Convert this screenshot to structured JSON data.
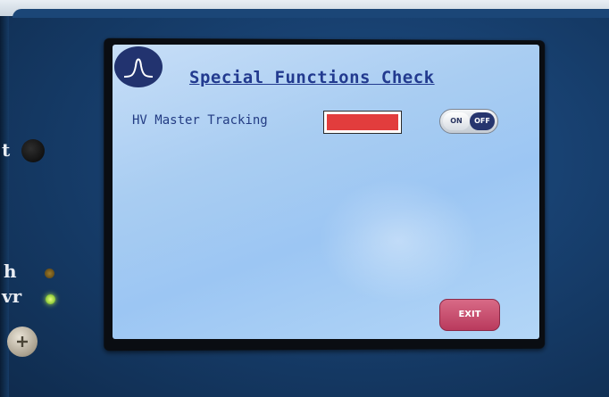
{
  "screen": {
    "title": "Special Functions Check",
    "logo_icon": "peak-icon",
    "rows": [
      {
        "label": "HV Master Tracking",
        "status_color": "#e23d3d",
        "toggle": {
          "on_label": "ON",
          "off_label": "OFF",
          "selected": "OFF"
        }
      }
    ],
    "exit_label": "EXIT"
  },
  "panel": {
    "left_labels": [
      "t",
      "h",
      "vr"
    ]
  }
}
